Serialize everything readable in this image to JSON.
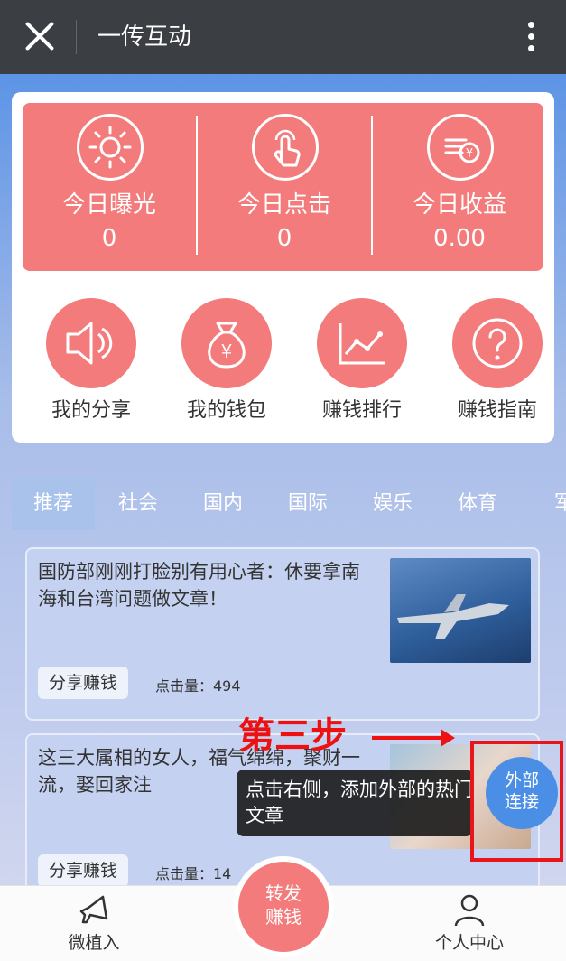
{
  "topbar": {
    "title": "一传互动"
  },
  "stats": [
    {
      "label": "今日曝光",
      "value": "0",
      "icon": "sun-icon"
    },
    {
      "label": "今日点击",
      "value": "0",
      "icon": "tap-hand-icon"
    },
    {
      "label": "今日收益",
      "value": "0.00",
      "icon": "coins-icon"
    }
  ],
  "menu": [
    {
      "label": "我的分享",
      "icon": "speaker-icon"
    },
    {
      "label": "我的钱包",
      "icon": "money-bag-icon"
    },
    {
      "label": "赚钱排行",
      "icon": "line-chart-icon"
    },
    {
      "label": "赚钱指南",
      "icon": "question-icon"
    }
  ],
  "tabs": [
    "推荐",
    "社会",
    "国内",
    "国际",
    "娱乐",
    "体育",
    "军"
  ],
  "articles": [
    {
      "title": "国防部刚刚打脸别有用心者：休要拿南海和台湾问题做文章！",
      "share_label": "分享赚钱",
      "clicks": "点击量：494"
    },
    {
      "title": "这三大属相的女人，福气绵绵，聚财一流，娶回家注",
      "share_label": "分享赚钱",
      "clicks": "点击量：14"
    }
  ],
  "annotation": {
    "step": "第三步",
    "tooltip": "点击右侧，添加外部的热门文章",
    "float_button": "外部\n连接"
  },
  "bottom_nav": {
    "left_label": "微植入",
    "center_label": "转发赚钱",
    "right_label": "个人中心"
  },
  "colors": {
    "accent": "#f37b7b",
    "topbar": "#3b3e42",
    "float_button": "#4b8ee6",
    "annotation": "#ee1111"
  }
}
